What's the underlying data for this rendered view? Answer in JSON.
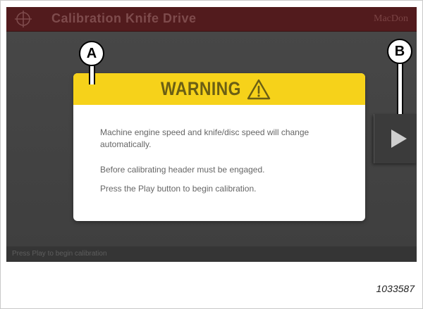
{
  "window": {
    "title": "Calibration Knife Drive",
    "brand": "MacDon",
    "crosshair_icon": "crosshair-icon"
  },
  "dialog": {
    "title": "WARNING",
    "icon": "warning-triangle-icon",
    "messages": [
      "Machine engine speed and knife/disc speed will change automatically.",
      "Before calibrating header must be engaged.",
      "Press the Play button to begin calibration."
    ]
  },
  "controls": {
    "play_icon": "play-icon"
  },
  "status": {
    "text": "Press Play to begin calibration"
  },
  "callouts": {
    "a": "A",
    "b": "B"
  },
  "figure": {
    "number": "1033587"
  },
  "colors": {
    "title_bar": "#521b1d",
    "warning_yellow": "#f6d21a",
    "screen_bg": "#434343"
  }
}
